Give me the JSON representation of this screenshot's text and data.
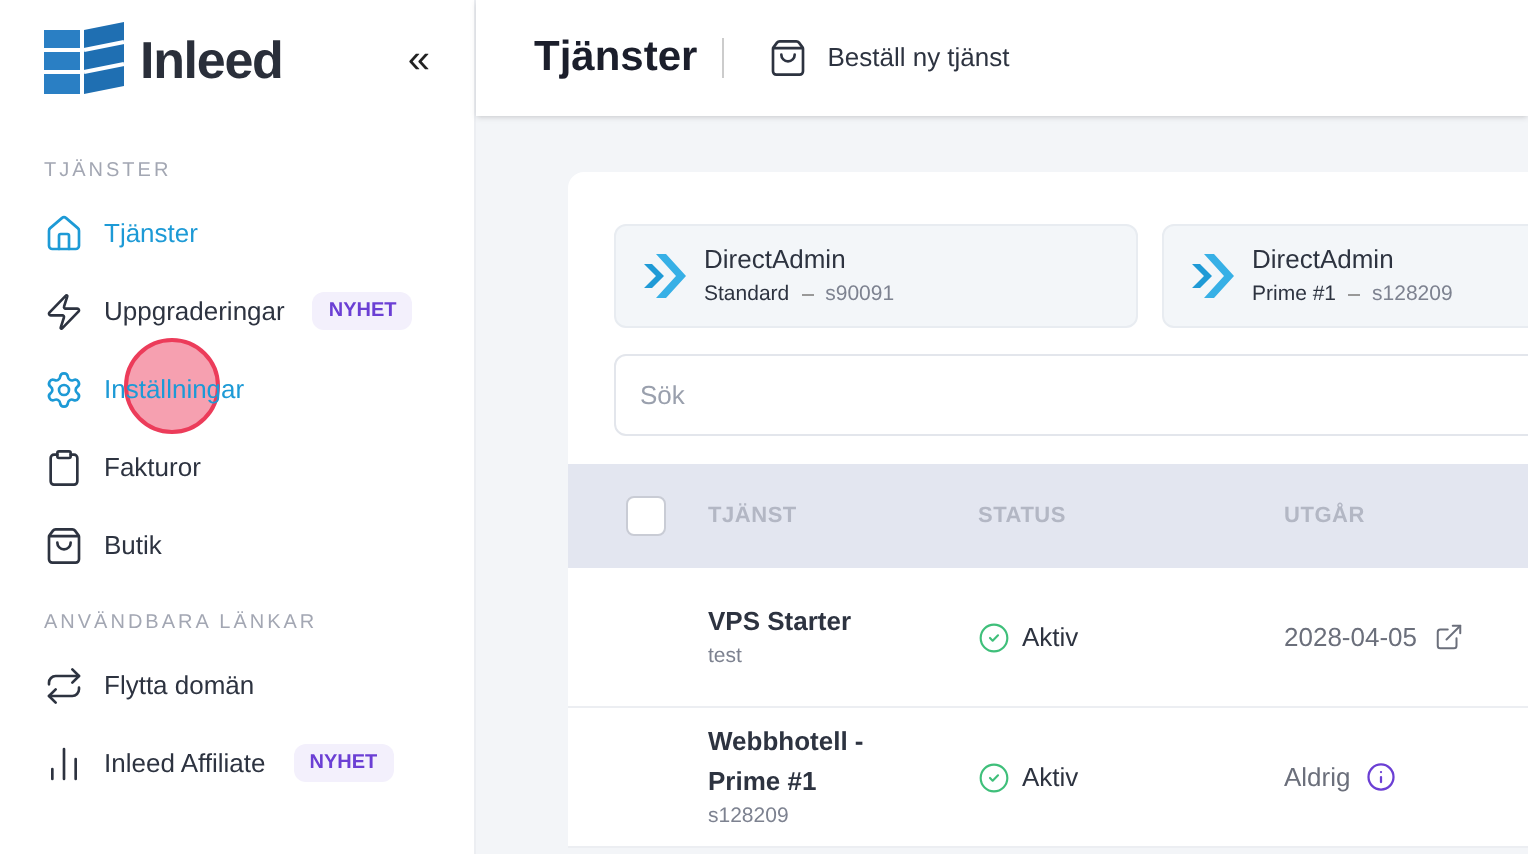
{
  "sidebar": {
    "logo_text": "Inleed",
    "collapse": "«",
    "sections": [
      {
        "heading": "TJÄNSTER",
        "items": [
          {
            "label": "Tjänster",
            "selected": true
          },
          {
            "label": "Uppgraderingar",
            "badge": "NYHET",
            "selected": false
          },
          {
            "label": "Inställningar",
            "selected": true
          },
          {
            "label": "Fakturor",
            "selected": false
          },
          {
            "label": "Butik",
            "selected": false
          }
        ]
      },
      {
        "heading": "ANVÄNDBARA LÄNKAR",
        "items": [
          {
            "label": "Flytta domän",
            "selected": false
          },
          {
            "label": "Inleed Affiliate",
            "badge": "NYHET",
            "selected": false
          }
        ]
      }
    ]
  },
  "touch_indicator": true,
  "header": {
    "title": "Tjänster",
    "action": "Beställ ny tjänst"
  },
  "tiles": [
    {
      "name": "DirectAdmin",
      "plan": "Standard",
      "id": "s90091"
    },
    {
      "name": "DirectAdmin",
      "plan": "Prime #1",
      "id": "s128209"
    }
  ],
  "search": {
    "placeholder": "Sök"
  },
  "table": {
    "select_all": {
      "checked": false
    },
    "columns": [
      "TJÄNST",
      "STATUS",
      "UTGÅR"
    ],
    "rows": [
      {
        "name": "VPS Starter",
        "sub": "test",
        "status": "Aktiv",
        "expires": "2028-04-05",
        "kind": "link"
      },
      {
        "name": "Webbhotell - Prime #1",
        "sub": "s128209",
        "status": "Aktiv",
        "expires": "Aldrig",
        "kind": "info"
      }
    ]
  }
}
